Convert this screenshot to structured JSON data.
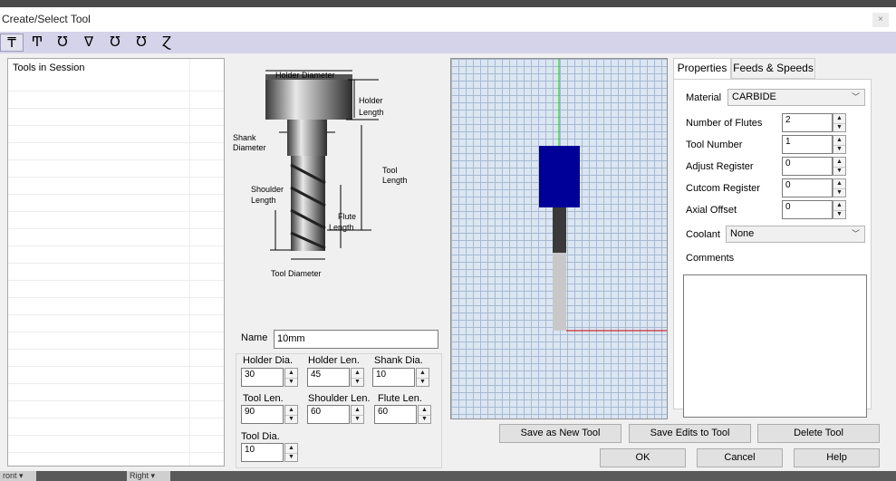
{
  "window": {
    "title": "Create/Select Tool",
    "close_glyph": "×"
  },
  "toolbar": {
    "tools": [
      {
        "icon": "end-mill-tool-icon",
        "glyph": "₸"
      },
      {
        "icon": "bull-nose-tool-icon",
        "glyph": "Ͳ"
      },
      {
        "icon": "ball-nose-tool-icon",
        "glyph": "Ʊ"
      },
      {
        "icon": "chamfer-tool-icon",
        "glyph": "∇"
      },
      {
        "icon": "engraving-tool-icon",
        "glyph": "Ʊ"
      },
      {
        "icon": "tapered-tool-icon",
        "glyph": "Ʊ"
      },
      {
        "icon": "drill-tool-icon",
        "glyph": "Ɀ"
      }
    ]
  },
  "session_list": {
    "header": "Tools in Session"
  },
  "diagram": {
    "holder_diameter": "Holder Diameter",
    "holder_length": [
      "Holder",
      "Length"
    ],
    "shank_diameter": [
      "Shank",
      "Diameter"
    ],
    "tool_length": [
      "Tool",
      "Length"
    ],
    "shoulder_length": [
      "Shoulder",
      "Length"
    ],
    "flute_length": [
      "Flute",
      "Length"
    ],
    "tool_diameter": "Tool Diameter"
  },
  "name": {
    "label": "Name",
    "value": "10mm"
  },
  "dims": {
    "holder_dia": {
      "label": "Holder Dia.",
      "value": "30"
    },
    "holder_len": {
      "label": "Holder Len.",
      "value": "45"
    },
    "shank_dia": {
      "label": "Shank Dia.",
      "value": "10"
    },
    "tool_len": {
      "label": "Tool Len.",
      "value": "90"
    },
    "shoulder_len": {
      "label": "Shoulder Len.",
      "value": "60"
    },
    "flute_len": {
      "label": "Flute Len.",
      "value": "60"
    },
    "tool_dia": {
      "label": "Tool Dia.",
      "value": "10"
    }
  },
  "tabs": {
    "properties": "Properties",
    "feeds": "Feeds & Speeds"
  },
  "properties": {
    "material_label": "Material",
    "material_value": "CARBIDE",
    "flutes_label": "Number of Flutes",
    "flutes_value": "2",
    "tool_number_label": "Tool Number",
    "tool_number_value": "1",
    "adjust_label": "Adjust Register",
    "adjust_value": "0",
    "cutcom_label": "Cutcom Register",
    "cutcom_value": "0",
    "axial_label": "Axial Offset",
    "axial_value": "0",
    "coolant_label": "Coolant",
    "coolant_value": "None",
    "comments_label": "Comments",
    "comments_value": ""
  },
  "buttons": {
    "save_new": "Save as New Tool",
    "save_edits": "Save Edits to Tool",
    "delete": "Delete Tool",
    "ok": "OK",
    "cancel": "Cancel",
    "help": "Help"
  },
  "preview_colors": {
    "holder": "#000099",
    "shank": "#3a3a3a",
    "flute": "#c8c8c8",
    "axis_y": "#00cc00",
    "axis_x": "#cc0000"
  },
  "background": {
    "left_tab": "ront ▾",
    "right_tab": "Right ▾"
  }
}
